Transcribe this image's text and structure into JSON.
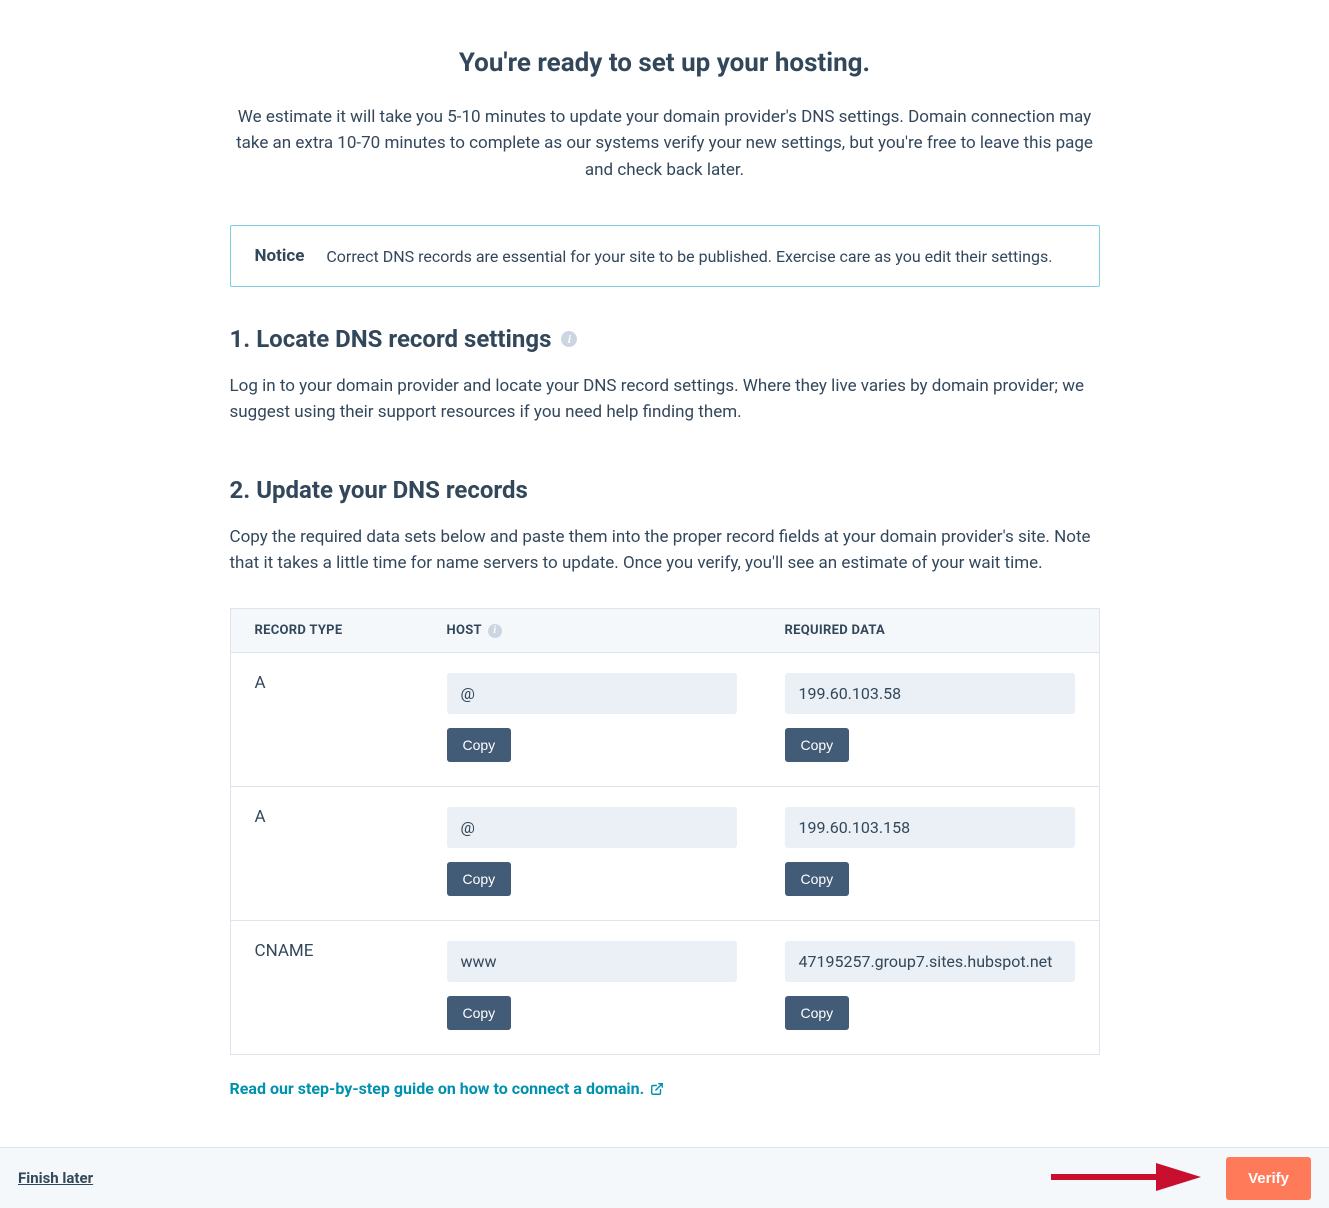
{
  "page": {
    "title": "You're ready to set up your hosting.",
    "intro": "We estimate it will take you 5-10 minutes to update your domain provider's DNS settings. Domain connection may take an extra 10-70 minutes to complete as our systems verify your new settings, but you're free to leave this page and check back later."
  },
  "notice": {
    "label": "Notice",
    "text": "Correct DNS records are essential for your site to be published. Exercise care as you edit their settings."
  },
  "section1": {
    "heading": "1. Locate DNS record settings",
    "text": "Log in to your domain provider and locate your DNS record settings. Where they live varies by domain provider; we suggest using their support resources if you need help finding them."
  },
  "section2": {
    "heading": "2. Update your DNS records",
    "text": "Copy the required data sets below and paste them into the proper record fields at your domain provider's site. Note that it takes a little time for name servers to update. Once you verify, you'll see an estimate of your wait time."
  },
  "table": {
    "headers": {
      "type": "RECORD TYPE",
      "host": "HOST",
      "data": "REQUIRED DATA"
    },
    "rows": [
      {
        "type": "A",
        "host": "@",
        "data": "199.60.103.58"
      },
      {
        "type": "A",
        "host": "@",
        "data": "199.60.103.158"
      },
      {
        "type": "CNAME",
        "host": "www",
        "data": "47195257.group7.sites.hubspot.net"
      }
    ],
    "copy_label": "Copy"
  },
  "guide_link": "Read our step-by-step guide on how to connect a domain.",
  "footer": {
    "finish_later": "Finish later",
    "verify": "Verify"
  }
}
